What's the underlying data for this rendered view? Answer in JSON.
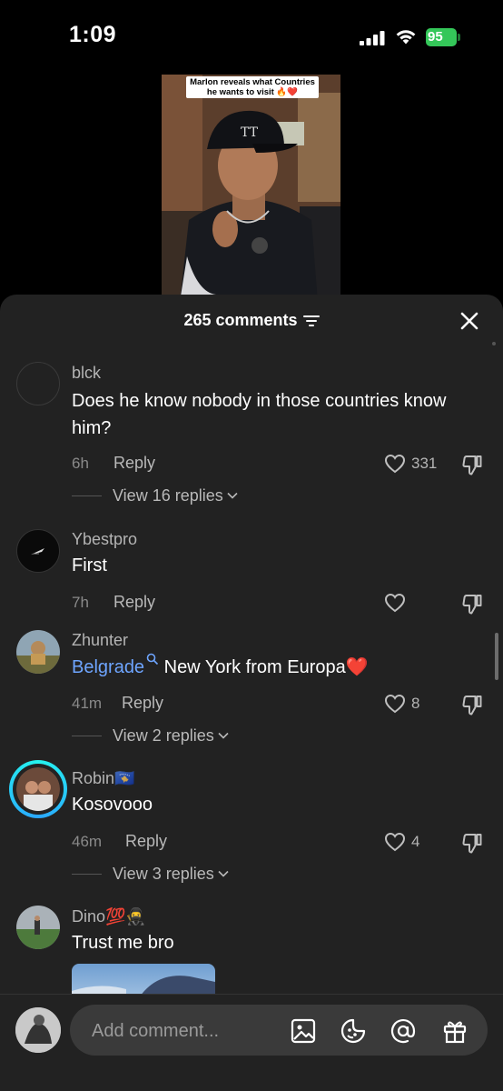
{
  "status_bar": {
    "time": "1:09",
    "battery": "95",
    "battery_color": "#34c759"
  },
  "video": {
    "caption_line1": "Marlon reveals what Countries",
    "caption_line2": "he wants to visit 🔥❤️"
  },
  "sheet": {
    "comments_count": "265 comments"
  },
  "comments": [
    {
      "username": "blck",
      "text": "Does he know nobody in those countries know him?",
      "time": "6h",
      "reply_label": "Reply",
      "likes": "331",
      "view_replies": "View 16 replies"
    },
    {
      "username": "Ybestpro",
      "text": "First",
      "time": "7h",
      "reply_label": "Reply",
      "likes": ""
    },
    {
      "username": "Zhunter",
      "tag": "Belgrade",
      "text": " New York from Europa❤️",
      "time": "41m",
      "reply_label": "Reply",
      "likes": "8",
      "view_replies": "View 2 replies"
    },
    {
      "username": "Robin🇽🇰",
      "text": "Kosovooo",
      "time": "46m",
      "reply_label": "Reply",
      "likes": "4",
      "view_replies": "View 3 replies"
    },
    {
      "username": "Dino💯🥷",
      "text": "Trust me bro"
    }
  ],
  "input": {
    "placeholder": "Add comment..."
  },
  "colors": {
    "sheet_bg": "#222222",
    "link": "#6ea5ff",
    "story_ring": "#25f4ee"
  }
}
